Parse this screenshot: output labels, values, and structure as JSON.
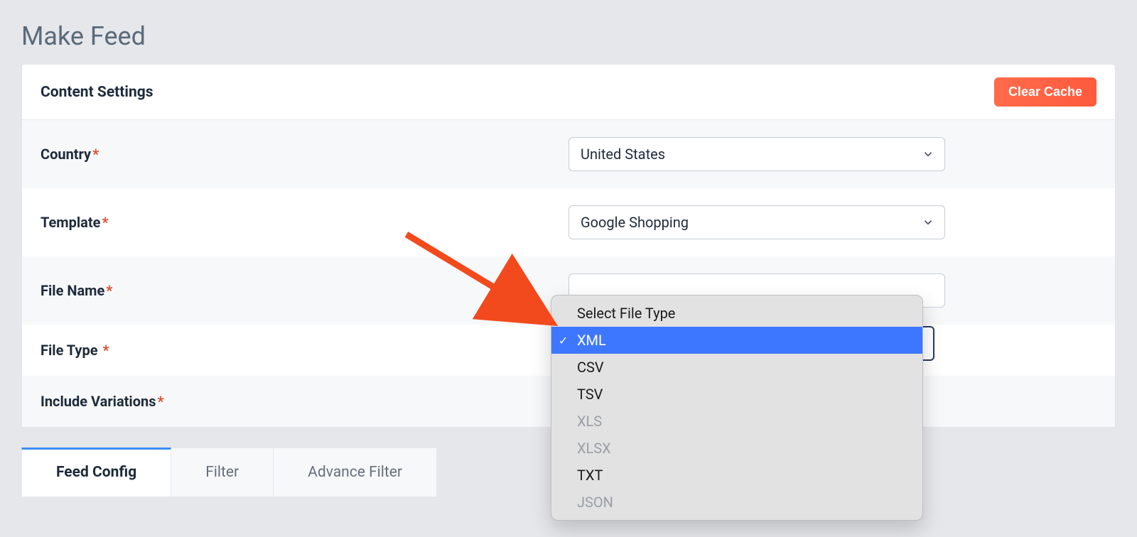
{
  "page": {
    "title": "Make Feed"
  },
  "panel": {
    "heading": "Content Settings",
    "clear_cache": "Clear Cache"
  },
  "fields": {
    "country": {
      "label": "Country",
      "value": "United States"
    },
    "template": {
      "label": "Template",
      "value": "Google Shopping"
    },
    "file_name": {
      "label": "File Name",
      "value": ""
    },
    "file_type": {
      "label": "File Type"
    },
    "include_variations": {
      "label": "Include Variations"
    }
  },
  "file_type_dropdown": {
    "header": "Select File Type",
    "options": [
      {
        "label": "XML",
        "selected": true,
        "disabled": false
      },
      {
        "label": "CSV",
        "selected": false,
        "disabled": false
      },
      {
        "label": "TSV",
        "selected": false,
        "disabled": false
      },
      {
        "label": "XLS",
        "selected": false,
        "disabled": true
      },
      {
        "label": "XLSX",
        "selected": false,
        "disabled": true
      },
      {
        "label": "TXT",
        "selected": false,
        "disabled": false
      },
      {
        "label": "JSON",
        "selected": false,
        "disabled": true
      }
    ]
  },
  "tabs": {
    "feed_config": "Feed Config",
    "filter": "Filter",
    "advance_filter": "Advance Filter"
  }
}
